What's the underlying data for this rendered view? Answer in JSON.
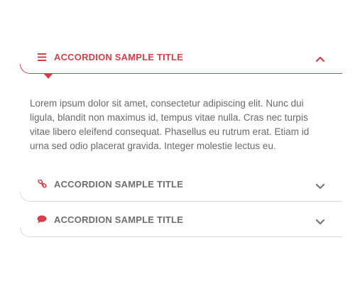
{
  "accordion": {
    "items": [
      {
        "title": "ACCORDION SAMPLE TITLE",
        "icon": "menu-lines-icon",
        "expanded": true,
        "body": "Lorem ipsum dolor sit amet, consectetur adipiscing elit. Nunc dui ligula, blandit non maximus id, tempus vitae nulla. Cras nec turpis vitae libero eleifend consequat. Phasellus eu rutrum erat. Etiam id urna sed odio placerat gravida. Integer molestie lectus eu."
      },
      {
        "title": "ACCORDION SAMPLE TITLE",
        "icon": "link-icon",
        "expanded": false
      },
      {
        "title": "ACCORDION SAMPLE TITLE",
        "icon": "comment-icon",
        "expanded": false
      }
    ]
  },
  "colors": {
    "accent": "#d4404a",
    "text": "#6a6a6a",
    "title_inactive": "#6f6f6f",
    "divider": "#dcdcdc"
  }
}
